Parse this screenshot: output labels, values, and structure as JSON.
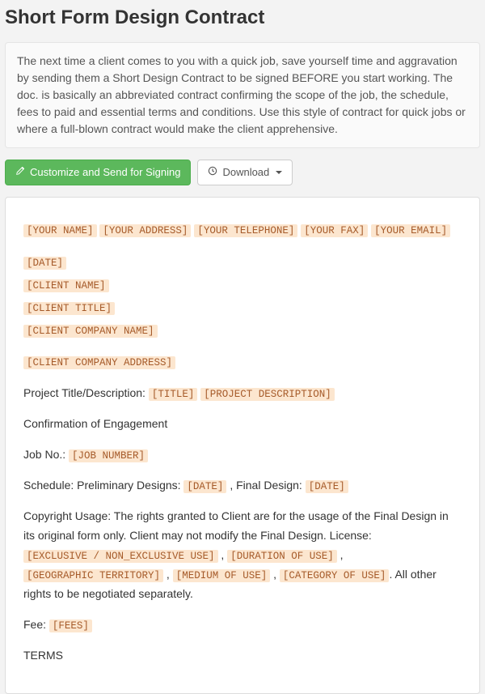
{
  "title": "Short Form Design Contract",
  "intro": "The next time a client comes to you with a quick job, save yourself time and aggravation by sending them a Short Design Contract to be signed BEFORE you start working. The doc. is basically an abbreviated contract confirming the scope of the job, the schedule, fees to paid and essential terms and conditions. Use this style of contract for quick jobs or where a full-blown contract would make the client apprehensive.",
  "toolbar": {
    "customize_label": "Customize and Send for Signing",
    "download_label": "Download"
  },
  "doc": {
    "header_tokens": [
      "[YOUR NAME]",
      "[YOUR ADDRESS]",
      "[YOUR TELEPHONE]",
      "[YOUR FAX]",
      "[YOUR EMAIL]"
    ],
    "client_block": [
      "[DATE]",
      "[CLIENT NAME]",
      "[CLIENT TITLE]",
      "[CLIENT COMPANY NAME]"
    ],
    "client_address": "[CLIENT COMPANY ADDRESS]",
    "project_label": "Project Title/Description: ",
    "project_tokens": [
      "[TITLE]",
      "[PROJECT DESCRIPTION]"
    ],
    "confirmation": "Confirmation of Engagement",
    "job_label": "Job No.: ",
    "job_token": "[JOB NUMBER]",
    "schedule_label_1": "Schedule: Preliminary Designs: ",
    "schedule_token_1": "[DATE]",
    "schedule_label_2": " , Final Design: ",
    "schedule_token_2": "[DATE]",
    "copyright_intro": "Copyright Usage: The rights granted to Client are for the usage of the Final Design in its original form only. Client may not modify the Final Design. License: ",
    "copyright_tokens": [
      "[EXCLUSIVE / NON_EXCLUSIVE USE]",
      "[DURATION OF USE]",
      "[GEOGRAPHIC TERRITORY]",
      "[MEDIUM OF USE]",
      "[CATEGORY OF USE]"
    ],
    "copyright_separator": " , ",
    "copyright_outro": ". All other rights to be negotiated separately.",
    "fee_label": "Fee: ",
    "fee_token": "[FEES]",
    "terms_heading": "TERMS"
  }
}
